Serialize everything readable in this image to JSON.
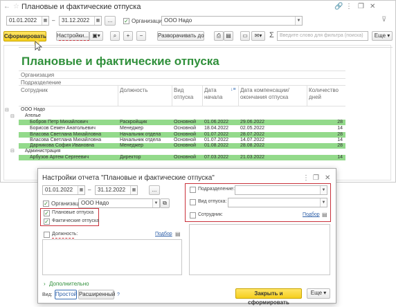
{
  "window": {
    "title": "Плановые и фактические отпуска",
    "date_from": "01.01.2022",
    "date_to": "31.12.2022",
    "dots": "...",
    "org_label": "Организация:",
    "org_value": "ООО Надо"
  },
  "toolbar": {
    "generate": "Сформировать",
    "settings": "Настройки...",
    "expand": "Разворачивать до",
    "search_placeholder": "Введите слово для фильтра (поиска)",
    "more": "Еще"
  },
  "report": {
    "title": "Плановые и фактические отпуска",
    "filters": [
      "Организация",
      "Подразделение"
    ],
    "columns": {
      "employee": "Сотрудник",
      "position": "Должность",
      "type": "Вид отпуска",
      "start": "Дата начала",
      "end": "Дата компенсации/окончания отпуска",
      "days": "Количество дней"
    },
    "group_org": "ООО Надо",
    "group_atelier": "Ателье",
    "group_admin": "Администрация",
    "rows": [
      {
        "employee": "Бобров Петр Михайлович",
        "position": "Раскройщик",
        "type": "Основной",
        "start": "01.06.2022",
        "end": "29.06.2022",
        "days": "28"
      },
      {
        "employee": "Борисов Семен Анатольевич",
        "position": "Менеджер",
        "type": "Основной",
        "start": "18.04.2022",
        "end": "02.05.2022",
        "days": "14"
      },
      {
        "employee": "Власова Светлана Михайловна",
        "position": "Начальник отдела",
        "type": "Основной",
        "start": "01.07.2022",
        "end": "28.07.2022",
        "days": "28"
      },
      {
        "employee": "Власова Светлана Михайловна",
        "position": "Начальник отдела",
        "type": "Основной",
        "start": "01.07.2022",
        "end": "14.07.2022",
        "days": "14"
      },
      {
        "employee": "Дарникова София Ивановна",
        "position": "Менеджер",
        "type": "Основной",
        "start": "01.08.2022",
        "end": "28.08.2022",
        "days": "28"
      },
      {
        "employee": "Арбузов Артем Сергеевич",
        "position": "Директор",
        "type": "Основной",
        "start": "07.03.2022",
        "end": "21.03.2022",
        "days": "14"
      }
    ]
  },
  "dialog": {
    "title": "Настройки отчета \"Плановые и фактические отпуска\"",
    "date_from": "01.01.2022",
    "date_to": "31.12.2022",
    "org_label": "Организация:",
    "org_value": "ООО Надо",
    "planned": "Плановые отпуска",
    "actual": "Фактические отпуска",
    "position": "Должность:",
    "pick": "Подбор",
    "division": "Подразделение:",
    "vac_type": "Вид отпуска:",
    "employee": "Сотрудник:",
    "more_settings": "Дополнительно",
    "view_label": "Вид:",
    "view_simple": "Простой",
    "view_extended": "Расширенный",
    "help": "?",
    "close_generate": "Закрыть и сформировать",
    "more": "Еще"
  }
}
